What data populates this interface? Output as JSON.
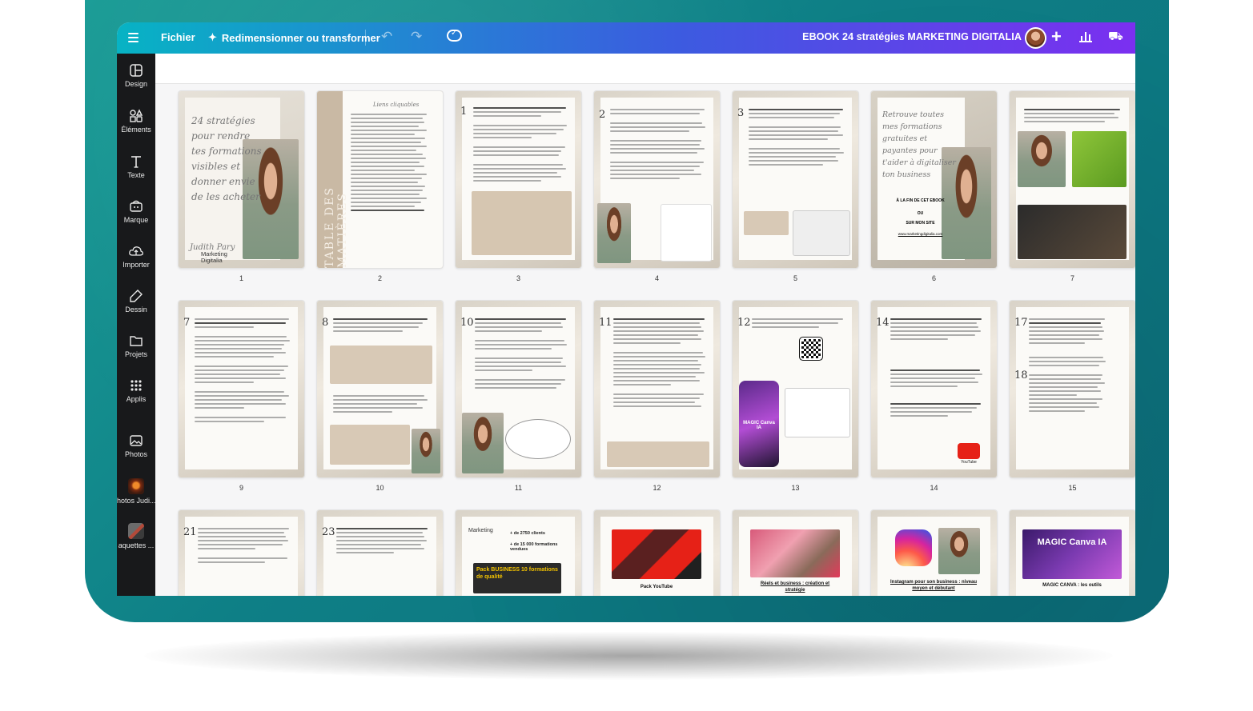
{
  "topbar": {
    "file_label": "Fichier",
    "resize_label": "Redimensionner ou transformer",
    "doc_title": "EBOOK 24 stratégies MARKETING DIGITALIA"
  },
  "sidebar": {
    "items": [
      {
        "label": "Design",
        "icon": "layout-icon"
      },
      {
        "label": "Éléments",
        "icon": "shapes-icon"
      },
      {
        "label": "Texte",
        "icon": "text-icon"
      },
      {
        "label": "Marque",
        "icon": "brand-icon"
      },
      {
        "label": "Importer",
        "icon": "cloud-upload-icon"
      },
      {
        "label": "Dessin",
        "icon": "pen-icon"
      },
      {
        "label": "Projets",
        "icon": "folder-icon"
      },
      {
        "label": "Applis",
        "icon": "apps-grid-icon"
      },
      {
        "label": "Photos",
        "icon": "photo-icon"
      },
      {
        "label": "hotos Judi...",
        "icon": "thumbnail"
      },
      {
        "label": "aquettes ...",
        "icon": "thumbnail"
      }
    ]
  },
  "pages": {
    "p1": {
      "num": "1",
      "title": "24 stratégies pour rendre tes formations visibles et donner envie de les acheter",
      "author": "Judith Pary",
      "brand": "Marketing Digitalia"
    },
    "p2": {
      "num": "2",
      "title": "TABLE DES MATIÈRES",
      "heading": "Liens cliquables"
    },
    "p3": {
      "num": "3"
    },
    "p4": {
      "num": "4"
    },
    "p5": {
      "num": "5"
    },
    "p6": {
      "num": "6",
      "title": "Retrouve toutes mes formations gratuites et payantes pour t'aider à digitaliser ton business",
      "line1": "À LA FIN DE CET EBOOK",
      "line2": "OU",
      "line3": "SUR MON SITE",
      "url": "www.marketingdigitalia.com"
    },
    "p7": {
      "num": "7"
    },
    "p8": {
      "num": "9"
    },
    "p9": {
      "num": "10"
    },
    "p10": {
      "num": "11"
    },
    "p11": {
      "num": "12"
    },
    "p12": {
      "num": "13",
      "brand": "MAGIC Canva IA"
    },
    "p13": {
      "num": "14",
      "badge": "YouTube"
    },
    "p14": {
      "num": "15"
    },
    "p15": {
      "num": ""
    },
    "p16": {
      "num": ""
    },
    "p17": {
      "num": "",
      "stat1": "+ de 2750 clients",
      "stat2": "+ de 15 000 formations vendues",
      "pack": "Pack BUSINESS 10 formations de qualité"
    },
    "p18": {
      "num": "",
      "caption": "Pack YouTube"
    },
    "p19": {
      "num": "",
      "caption": "Réels et business : création et stratégie"
    },
    "p20": {
      "num": "",
      "caption": "Instagram pour son business : niveau moyen et débutant"
    },
    "p21": {
      "num": "",
      "caption": "MAGIC CANVA : les outils",
      "brand": "MAGIC Canva IA"
    }
  }
}
